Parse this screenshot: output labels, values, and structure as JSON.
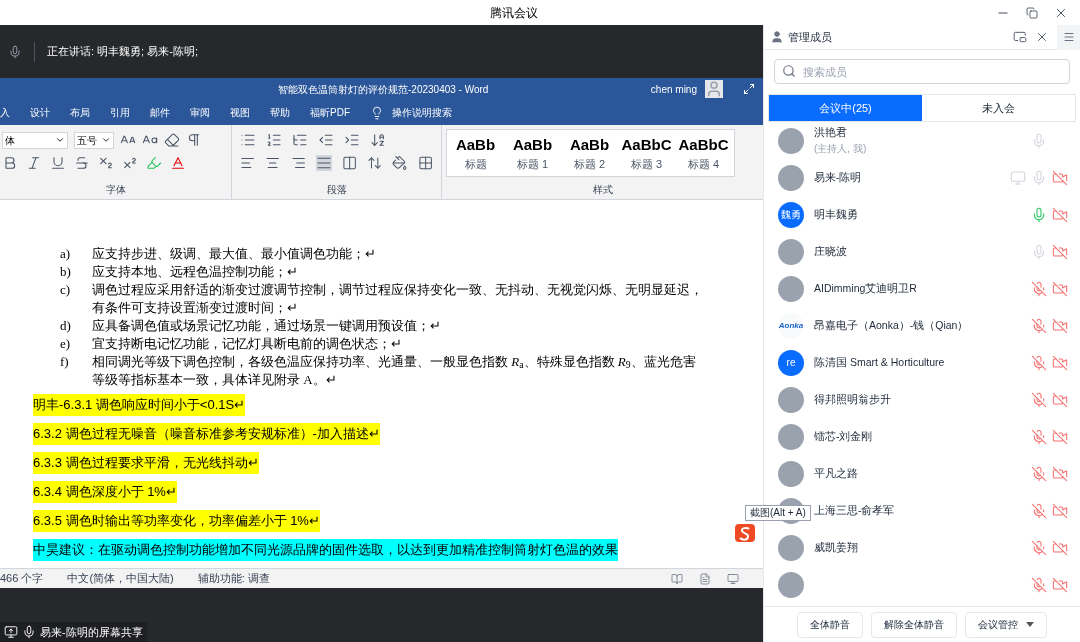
{
  "window": {
    "title": "腾讯会议"
  },
  "speaking_bar": {
    "text": "正在讲话: 明丰魏勇; 易来-陈明;"
  },
  "word": {
    "title": "智能双色温筒射灯的评价规范-20230403  -  Word",
    "user": "chen ming",
    "ribbon_tabs": [
      "入",
      "设计",
      "布局",
      "引用",
      "邮件",
      "审阅",
      "视图",
      "帮助",
      "福昕PDF"
    ],
    "tell_me": "操作说明搜索",
    "font_name": "体",
    "font_size": "五号",
    "groups": [
      "字体",
      "段落",
      "样式"
    ],
    "styles": [
      {
        "sample": "AaBb",
        "label": "标题"
      },
      {
        "sample": "AaBb",
        "label": "标题 1"
      },
      {
        "sample": "AaBb",
        "label": "标题 2"
      },
      {
        "sample": "AaBbC",
        "label": "标题 3"
      },
      {
        "sample": "AaBbC",
        "label": "标题 4"
      }
    ],
    "list": [
      {
        "marker": "a)",
        "text": "应支持步进、级调、最大值、最小值调色功能；↵"
      },
      {
        "marker": "b)",
        "text": "应支持本地、远程色温控制功能；↵"
      },
      {
        "marker": "c)",
        "text": "调色过程应采用舒适的渐变过渡调节控制，调节过程应保持变化一致、无抖动、无视觉闪烁、无明显延迟，有条件可支持设置渐变过渡时间；↵"
      },
      {
        "marker": "d)",
        "text": "应具备调色值或场景记忆功能，通过场景一键调用预设值；↵"
      },
      {
        "marker": "e)",
        "text": "宜支持断电记忆功能，记忆灯具断电前的调色状态；↵"
      },
      {
        "marker": "f)",
        "text": "相同调光等级下调色控制，各级色温应保持功率、光通量、一般显色指数 *R*$_{a}$、特殊显色指数 *R*$_{9}$、蓝光危害等级等指标基本一致，具体详见附录 A。↵"
      }
    ],
    "highlights": [
      {
        "text": "明丰-6.3.1  调色响应时间小于<0.1S↵",
        "color": "#ffff00"
      },
      {
        "text": "6.3.2  调色过程无噪音（噪音标准参考安规标准）-加入描述↵",
        "color": "#ffff00"
      },
      {
        "text": "6.3.3  调色过程要求平滑，无光线抖动↵",
        "color": "#ffff00"
      },
      {
        "text": "6.3.4 调色深度小于 1%↵",
        "color": "#ffff00"
      },
      {
        "text": "6.3.5 调色时输出等功率变化，功率偏差小于 1%↵",
        "color": "#ffff00"
      },
      {
        "text": "中昊建议：在驱动调色控制功能增加不同光源品牌的固件选取，以达到更加精准控制筒射灯色温的效果",
        "color": "#00ffff"
      }
    ],
    "status": [
      "466 个字",
      "中文(简体，中国大陆)",
      "辅助功能: 调查"
    ]
  },
  "share_label": "易来-陈明的屏幕共享",
  "tooltip": "截图(Alt + A)",
  "members": {
    "title": "管理成员",
    "search": {
      "placeholder": "搜索成员"
    },
    "tabs": [
      {
        "label": "会议中(25)",
        "selected": true
      },
      {
        "label": "未入会",
        "selected": false
      }
    ],
    "people": [
      {
        "name": "洪艳君",
        "subtitle": "(主持人, 我)",
        "avatar": {
          "kind": "photo"
        },
        "muted": false,
        "speaking": false,
        "camera_off": false,
        "sharing": false
      },
      {
        "name": "易来-陈明",
        "avatar": {
          "kind": "photo"
        },
        "muted": false,
        "speaking": false,
        "camera_off": true,
        "sharing": true
      },
      {
        "name": "明丰魏勇",
        "avatar": {
          "kind": "text",
          "text": "魏勇"
        },
        "muted": false,
        "speaking": true,
        "camera_off": true,
        "sharing": false
      },
      {
        "name": "庄晓波",
        "avatar": {
          "kind": "photo"
        },
        "muted": false,
        "speaking": false,
        "camera_off": true,
        "sharing": false
      },
      {
        "name": "AIDimming艾迪明卫R",
        "avatar": {
          "kind": "photo"
        },
        "muted": true,
        "speaking": false,
        "camera_off": true,
        "sharing": false
      },
      {
        "name": "昂嘉电子（Aonka）-钱（Qian）",
        "avatar": {
          "kind": "logo",
          "text": "Aonka"
        },
        "muted": true,
        "speaking": false,
        "camera_off": true,
        "sharing": false
      },
      {
        "name": "陈清国 Smart & Horticulture",
        "avatar": {
          "kind": "text",
          "text": "re"
        },
        "muted": true,
        "speaking": false,
        "camera_off": true,
        "sharing": false
      },
      {
        "name": "得邦照明翁步升",
        "avatar": {
          "kind": "photo"
        },
        "muted": true,
        "speaking": false,
        "camera_off": true,
        "sharing": false
      },
      {
        "name": "镭芯-刘金刚",
        "avatar": {
          "kind": "photo"
        },
        "muted": true,
        "speaking": false,
        "camera_off": true,
        "sharing": false
      },
      {
        "name": "平凡之路",
        "avatar": {
          "kind": "photo"
        },
        "muted": true,
        "speaking": false,
        "camera_off": true,
        "sharing": false
      },
      {
        "name": "上海三思-俞孝军",
        "avatar": {
          "kind": "photo"
        },
        "muted": true,
        "speaking": false,
        "camera_off": true,
        "sharing": false
      },
      {
        "name": "威凯姜翔",
        "avatar": {
          "kind": "photo"
        },
        "muted": true,
        "speaking": false,
        "camera_off": true,
        "sharing": false
      },
      {
        "avatar": {
          "kind": "photo"
        },
        "muted": true,
        "speaking": false,
        "camera_off": true,
        "sharing": false
      }
    ],
    "buttons": [
      {
        "label": "全体静音",
        "dropdown": false
      },
      {
        "label": "解除全体静音",
        "dropdown": false
      },
      {
        "label": "会议管控",
        "dropdown": true
      }
    ]
  }
}
